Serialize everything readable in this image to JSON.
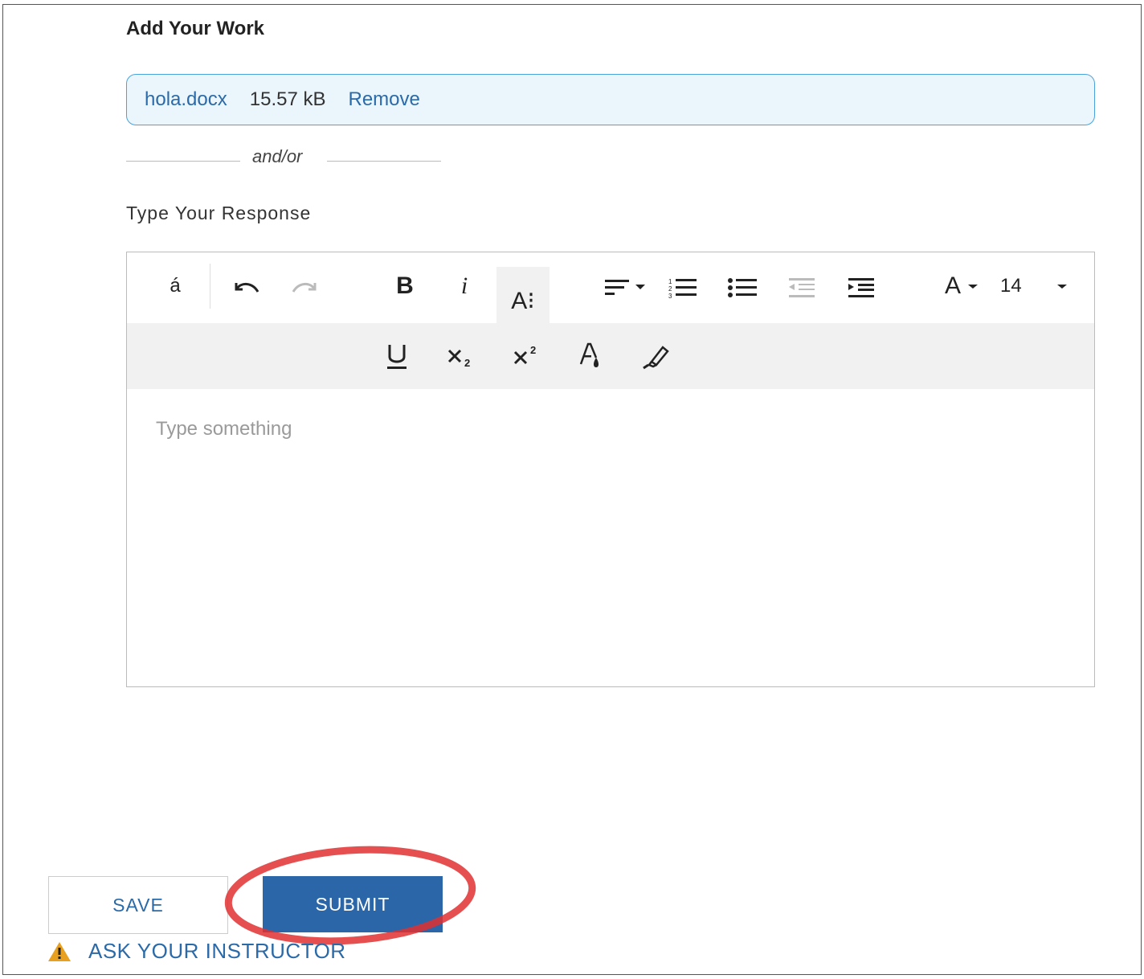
{
  "section_title": "Add Your Work",
  "attachment": {
    "file_name": "hola.docx",
    "file_size": "15.57 kB",
    "remove_label": "Remove"
  },
  "separator_text": "and/or",
  "response_label": "Type Your Response",
  "editor": {
    "placeholder": "Type something",
    "toolbar": {
      "special_char_label": "á",
      "font_size_value": "14",
      "font_family_label": "A",
      "icons_row1": [
        "special-characters",
        "undo",
        "redo",
        "bold",
        "italic",
        "text-case",
        "align",
        "numbered-list",
        "bulleted-list",
        "outdent",
        "indent",
        "font-family",
        "font-size"
      ],
      "icons_row2": [
        "underline",
        "subscript",
        "superscript",
        "text-color",
        "highlight"
      ]
    }
  },
  "actions": {
    "save_label": "SAVE",
    "submit_label": "SUBMIT"
  },
  "help": {
    "ask_label": "ASK YOUR INSTRUCTOR",
    "icon": "warning-icon"
  },
  "colors": {
    "link_blue": "#2b6aa8",
    "submit_bg": "#2b66a8",
    "file_box_bg": "#eaf5fc",
    "file_box_border": "#4aa3dd",
    "highlight_circle": "#e03030",
    "warning": "#e8a020"
  }
}
